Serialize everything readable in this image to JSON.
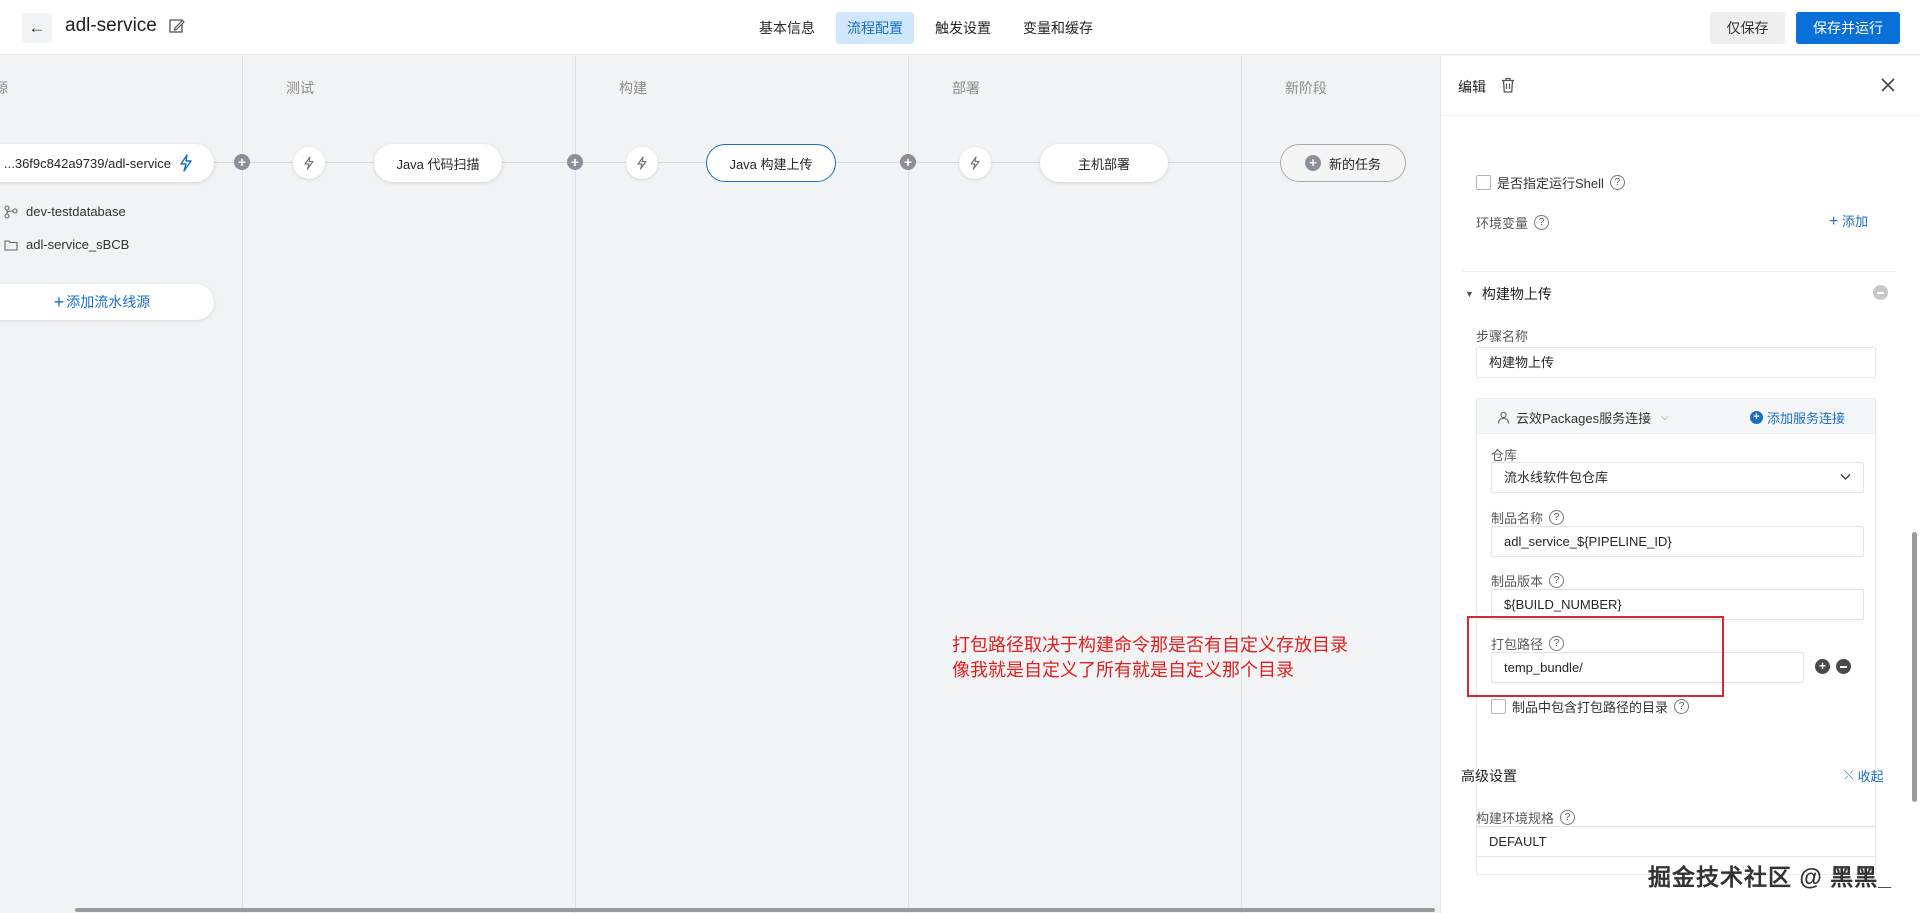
{
  "header": {
    "app_title": "adl-service",
    "tabs": [
      "基本信息",
      "流程配置",
      "触发设置",
      "变量和缓存"
    ],
    "active_tab": "流程配置",
    "save_only_label": "仅保存",
    "save_run_label": "保存并运行"
  },
  "canvas": {
    "stages": [
      "源",
      "测试",
      "构建",
      "部署",
      "新阶段"
    ],
    "source": {
      "repo": "...36f9c842a9739/adl-service",
      "branch": "dev-testdatabase",
      "folder": "adl-service_sBCB",
      "add_source_label": "添加流水线源"
    },
    "tasks": {
      "test": "Java 代码扫描",
      "build": "Java 构建上传",
      "deploy": "主机部署",
      "new_task": "新的任务"
    },
    "annotation_line1": "打包路径取决于构建命令那是否有自定义存放目录",
    "annotation_line2": "像我就是自定义了所有就是自定义那个目录"
  },
  "panel": {
    "title": "编辑",
    "shell_checkbox_label": "是否指定运行Shell",
    "env_label": "环境变量",
    "env_add": "添加",
    "section_title": "构建物上传",
    "step_name_label": "步骤名称",
    "step_name_value": "构建物上传",
    "service_connection": "云效Packages服务连接",
    "add_service_connection": "添加服务连接",
    "repo_label": "仓库",
    "repo_value": "流水线软件包仓库",
    "artifact_name_label": "制品名称",
    "artifact_name_value": "adl_service_${PIPELINE_ID}",
    "artifact_version_label": "制品版本",
    "artifact_version_value": "${BUILD_NUMBER}",
    "package_path_label": "打包路径",
    "package_path_value": "temp_bundle/",
    "include_dir_label": "制品中包含打包路径的目录",
    "advanced_title": "高级设置",
    "collapse_label": "收起",
    "build_env_label": "构建环境规格",
    "build_env_value": "DEFAULT"
  },
  "watermark": "掘金技术社区 @ 黑黑_"
}
